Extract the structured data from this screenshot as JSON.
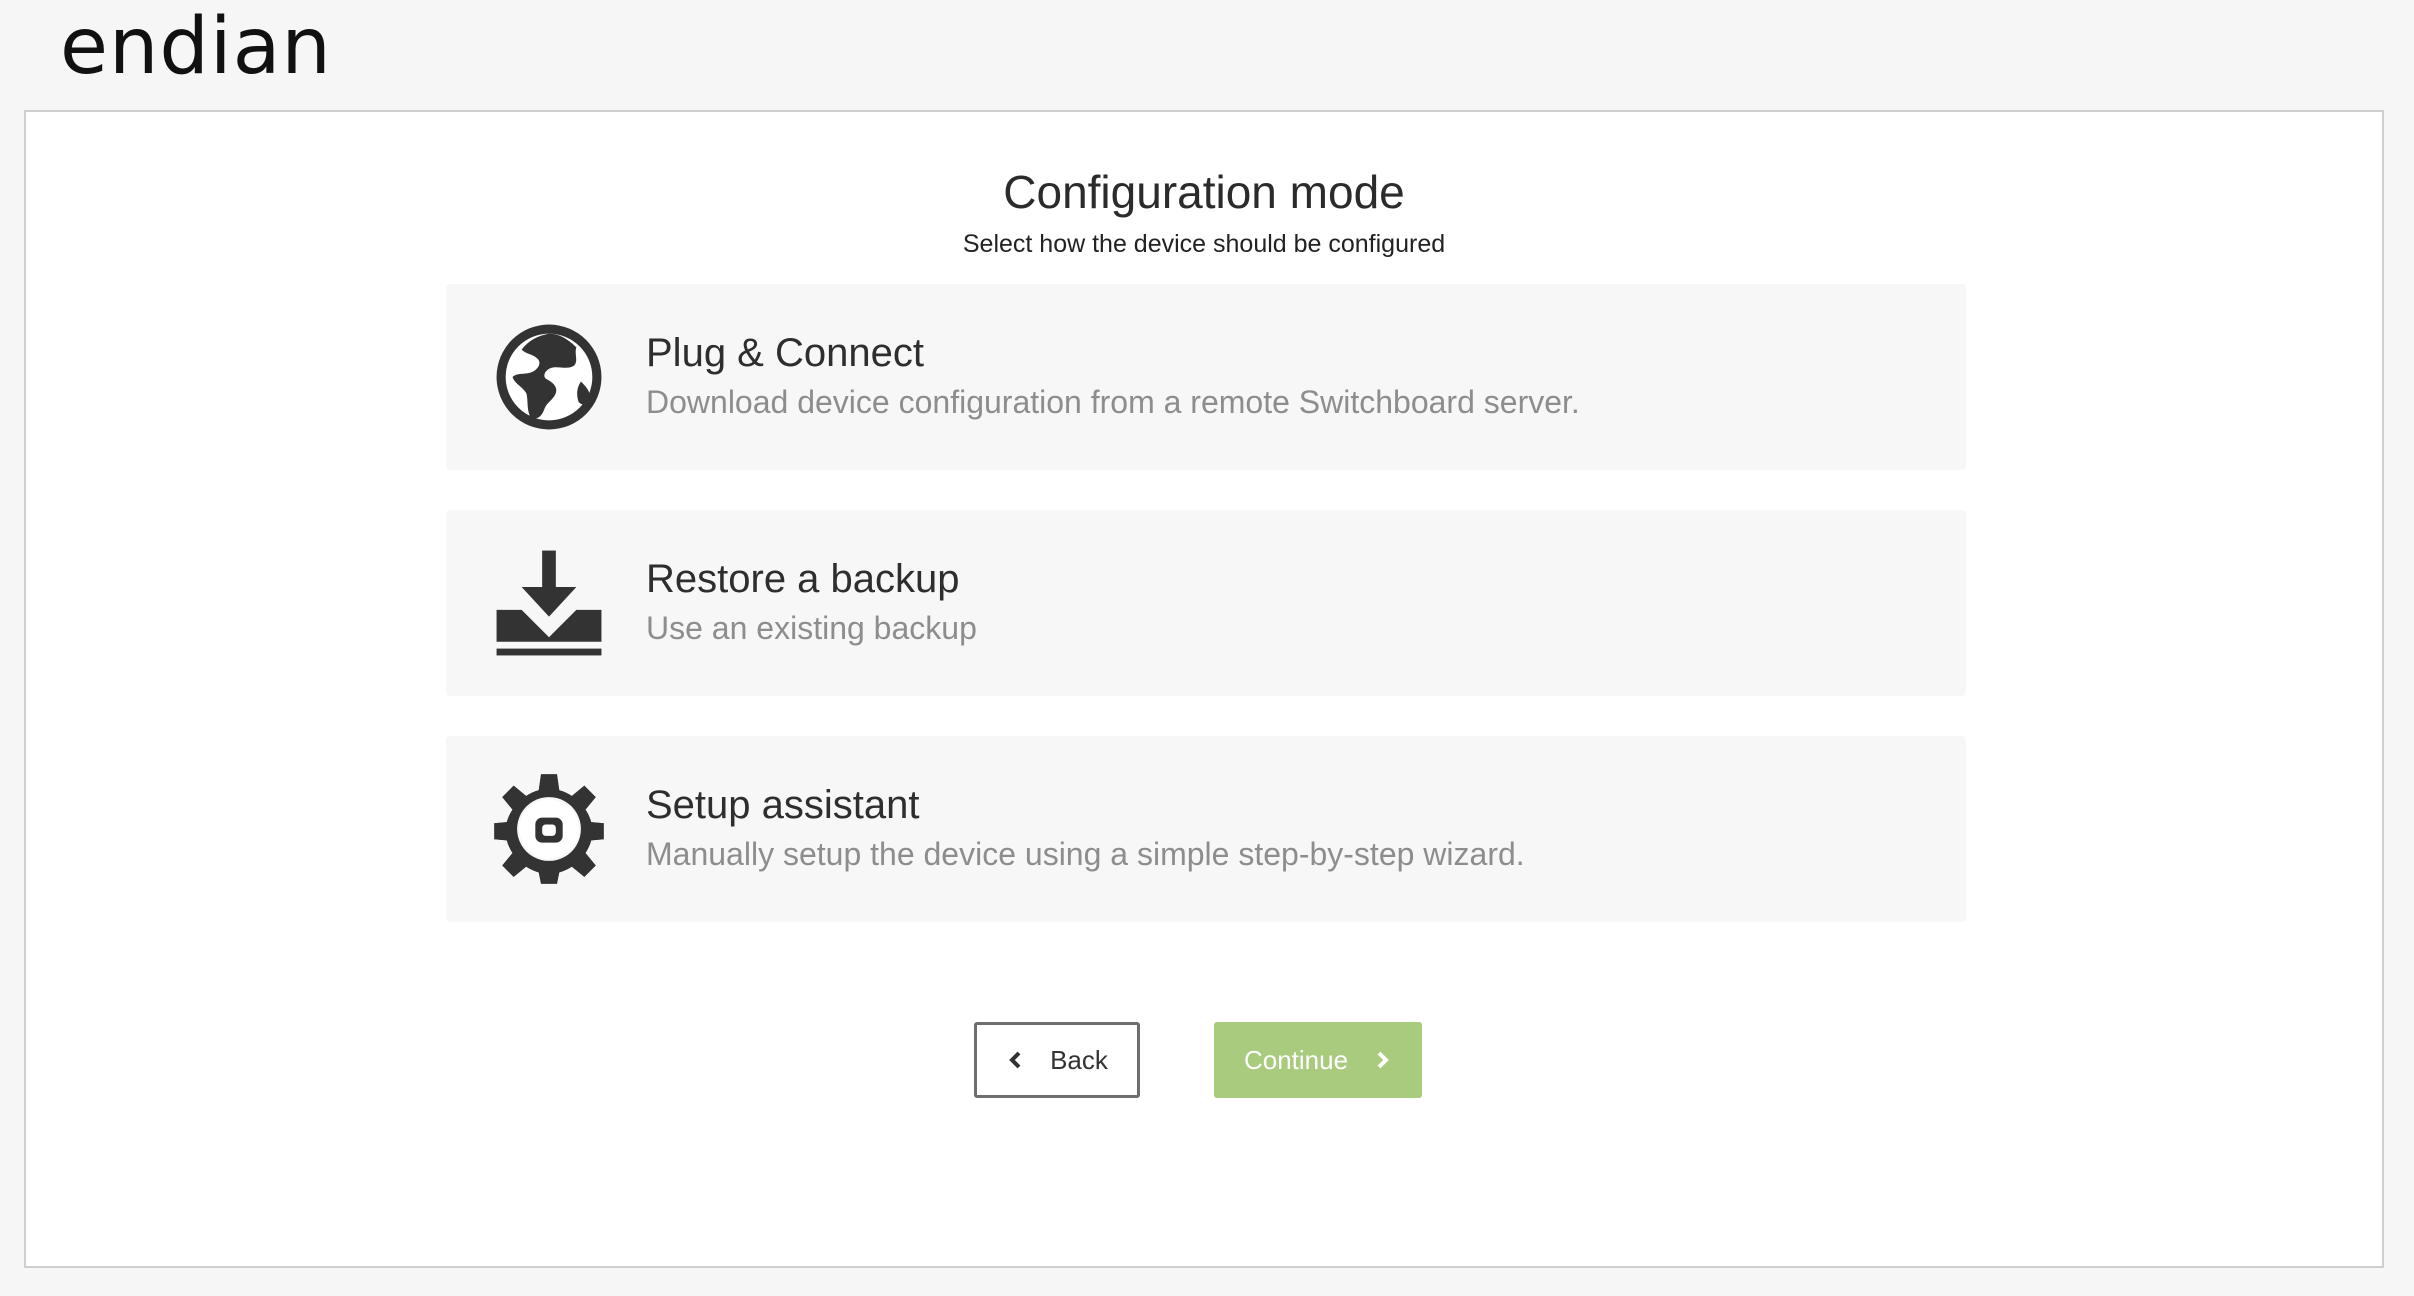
{
  "brand": {
    "logo_text": "endian"
  },
  "page": {
    "title": "Configuration mode",
    "subtitle": "Select how the device should be configured"
  },
  "options": [
    {
      "icon": "globe-icon",
      "title": "Plug & Connect",
      "description": "Download device configuration from a remote Switchboard server."
    },
    {
      "icon": "download-icon",
      "title": "Restore a backup",
      "description": "Use an existing backup"
    },
    {
      "icon": "gear-icon",
      "title": "Setup assistant",
      "description": "Manually setup the device using a simple step-by-step wizard."
    }
  ],
  "buttons": {
    "back_label": "Back",
    "continue_label": "Continue"
  },
  "colors": {
    "accent": "#a9cb7d",
    "card_bg": "#f7f7f7",
    "icon": "#333333",
    "description": "#8d8d8d"
  }
}
